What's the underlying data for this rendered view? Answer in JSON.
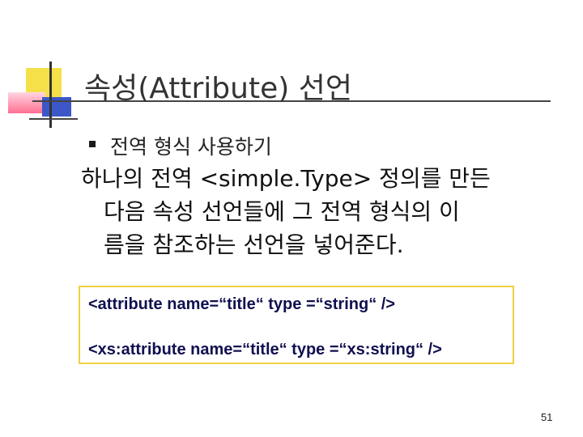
{
  "slide": {
    "title": "속성(Attribute) 선언",
    "bullet": "전역 형식 사용하기",
    "body_lines": [
      "하나의 전역 <simple.Type> 정의를 만든",
      "다음 속성 선언들에 그 전역 형식의 이",
      "름을 참조하는 선언을 넣어준다."
    ],
    "code_lines": [
      "<attribute name=“title“ type =“string“ />",
      "<xs:attribute name=“title“ type =“xs:string“ />"
    ],
    "page_number": "51"
  },
  "colors": {
    "accent_yellow": "#f5e04a",
    "accent_blue": "#3b57c8",
    "accent_pink": "#ff6f93",
    "code_border": "#f0d040",
    "code_text": "#101050"
  }
}
